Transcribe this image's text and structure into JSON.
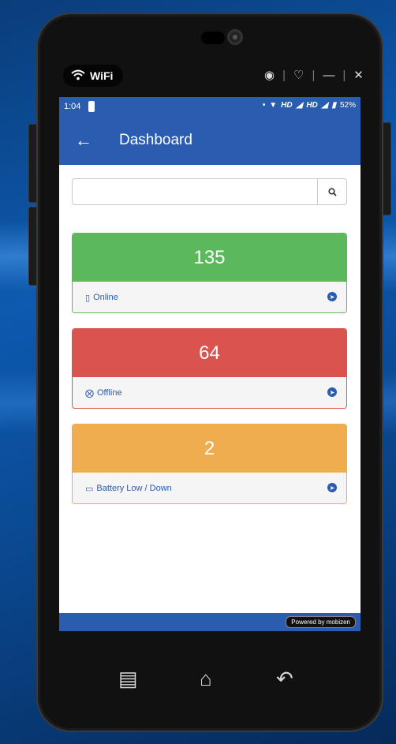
{
  "overlay": {
    "wifi_label": "WiFi"
  },
  "statusbar": {
    "time": "1:04",
    "network_1": "HD",
    "network_2": "HD",
    "battery": "52%"
  },
  "appbar": {
    "title": "Dashboard",
    "back_icon": "arrow-left-icon"
  },
  "search": {
    "value": "",
    "placeholder": "",
    "button_icon": "search-icon"
  },
  "cards": [
    {
      "count": "135",
      "label": "Online",
      "icon": "mobile-icon",
      "color": "#5cb85c"
    },
    {
      "count": "64",
      "label": "Offline",
      "icon": "times-circle-icon",
      "color": "#d9534f"
    },
    {
      "count": "2",
      "label": "Battery Low / Down",
      "icon": "battery-icon",
      "color": "#f0ad4e"
    }
  ],
  "footer": {
    "powered_by": "Powered by mobizen"
  },
  "colors": {
    "primary": "#2a5db0"
  }
}
